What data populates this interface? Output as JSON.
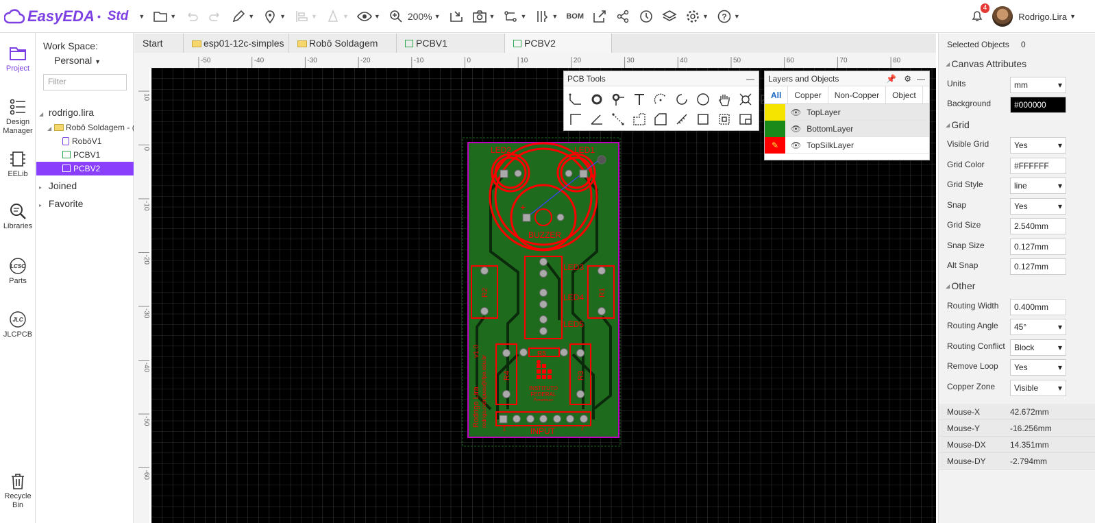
{
  "app": {
    "name": "EasyEDA",
    "edition": "Std"
  },
  "toolbar": {
    "zoom": "200%",
    "bom_label": "BOM"
  },
  "user": {
    "name": "Rodrigo.Lira",
    "notifications": "4"
  },
  "rail": [
    {
      "label": "Project",
      "icon": "folder-icon"
    },
    {
      "label": "Design Manager",
      "icon": "list-icon"
    },
    {
      "label": "EELib",
      "icon": "chip-icon"
    },
    {
      "label": "Libraries",
      "icon": "search-icon"
    },
    {
      "label": "Parts",
      "icon": "lcsc-icon"
    },
    {
      "label": "JLCPCB",
      "icon": "jlc-icon"
    },
    {
      "label": "Recycle Bin",
      "icon": "trash-icon"
    }
  ],
  "project": {
    "workspace_label": "Work Space:",
    "workspace_value": "Personal",
    "filter_placeholder": "Filter",
    "tree": {
      "owner": "rodrigo.lira",
      "folder": "Robô Soldagem - (",
      "items": [
        "RobôV1",
        "PCBV1",
        "PCBV2"
      ],
      "joined": "Joined",
      "favorite": "Favorite"
    }
  },
  "tabs": [
    "Start",
    "esp01-12c-simples",
    "Robô Soldagem",
    "PCBV1",
    "PCBV2"
  ],
  "ruler": {
    "top": [
      "-50",
      "-40",
      "-30",
      "-20",
      "-10",
      "0",
      "10",
      "20",
      "30",
      "40",
      "50",
      "60",
      "70",
      "80"
    ],
    "left": [
      "10",
      "0",
      "-10",
      "-20",
      "-30",
      "-40",
      "-50",
      "-60"
    ]
  },
  "pcb_labels": {
    "led2": "LED2",
    "led1": "LED1",
    "buzzer": "BUZZER",
    "plus": "+",
    "led3": "LED3",
    "led4": "LED4",
    "led5": "LED5",
    "r1": "R1",
    "r2": "R2",
    "r3": "R3",
    "r4": "R4",
    "r5": "R5",
    "input": "INPUT",
    "pin1": "1",
    "pin7": "7",
    "version": "v1.0",
    "author": "Rodrigo Lira",
    "email": "rodrigo.rodrigues@ifpe.edu.br",
    "inst1": "INSTITUTO",
    "inst2": "FEDERAL",
    "inst3": "Pernambuco"
  },
  "pcb_tools": {
    "title": "PCB Tools",
    "minimize": "—"
  },
  "layers": {
    "title": "Layers and Objects",
    "tabs": [
      "All",
      "Copper",
      "Non-Copper",
      "Object"
    ],
    "rows": [
      {
        "name": "TopLayer",
        "color": "#f5e400"
      },
      {
        "name": "BottomLayer",
        "color": "#1a8a1a"
      },
      {
        "name": "TopSilkLayer",
        "color": "#ff0000"
      }
    ]
  },
  "right": {
    "selected_label": "Selected Objects",
    "selected_count": "0",
    "canvas_title": "Canvas Attributes",
    "units_label": "Units",
    "units": "mm",
    "background_label": "Background",
    "background": "#000000",
    "grid_title": "Grid",
    "visible_grid_label": "Visible Grid",
    "visible_grid": "Yes",
    "grid_color_label": "Grid Color",
    "grid_color": "#FFFFFF",
    "grid_style_label": "Grid Style",
    "grid_style": "line",
    "snap_label": "Snap",
    "snap": "Yes",
    "grid_size_label": "Grid Size",
    "grid_size": "2.540mm",
    "snap_size_label": "Snap Size",
    "snap_size": "0.127mm",
    "alt_snap_label": "Alt Snap",
    "alt_snap": "0.127mm",
    "other_title": "Other",
    "routing_width_label": "Routing Width",
    "routing_width": "0.400mm",
    "routing_angle_label": "Routing Angle",
    "routing_angle": "45°",
    "routing_conflict_label": "Routing Conflict",
    "routing_conflict": "Block",
    "remove_loop_label": "Remove Loop",
    "remove_loop": "Yes",
    "copper_zone_label": "Copper Zone",
    "copper_zone": "Visible",
    "mouse_x_label": "Mouse-X",
    "mouse_x": "42.672mm",
    "mouse_y_label": "Mouse-Y",
    "mouse_y": "-16.256mm",
    "mouse_dx_label": "Mouse-DX",
    "mouse_dx": "14.351mm",
    "mouse_dy_label": "Mouse-DY",
    "mouse_dy": "-2.794mm"
  },
  "colors": {
    "accent": "#7b3fe4",
    "silk": "#ff0000",
    "board": "#1e6b1e",
    "outline": "#c000c0"
  }
}
